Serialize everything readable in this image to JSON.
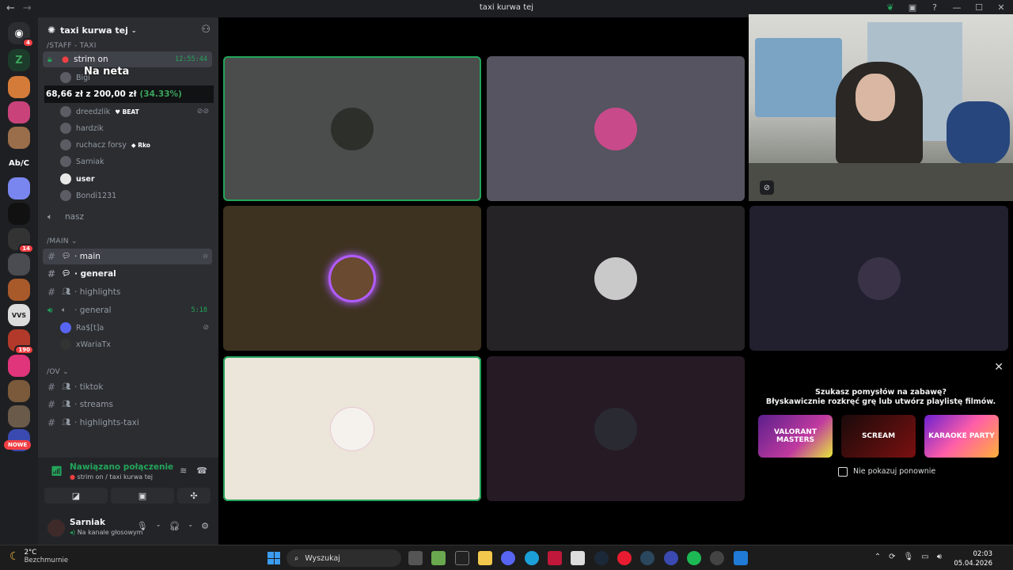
{
  "window": {
    "title": "taxi kurwa tej",
    "back_icon": "←",
    "forward_icon": "→"
  },
  "rail": {
    "badges": {
      "discord": "4",
      "server_14": "14",
      "server_190": "190"
    },
    "abc_label": "Ab/C",
    "vvs_label": "VVS",
    "new_label": "NOWE"
  },
  "sidebar": {
    "server_name": "taxi kurwa tej",
    "categories": {
      "staff": "/STAFF - TAXI",
      "main": "/MAIN",
      "ov": "/OV"
    },
    "voice_channel": {
      "name": "strim on",
      "time": "12:55:44"
    },
    "voice_users": [
      {
        "name": "Bigi"
      },
      {
        "name": "dreedzlik",
        "tag": "BEAT"
      },
      {
        "name": "hardzik"
      },
      {
        "name": "ruchacz forsy",
        "tag": "Rko"
      },
      {
        "name": "Sarniak"
      },
      {
        "name": "user"
      },
      {
        "name": "Bondi1231"
      }
    ],
    "nasz_label": "nasz",
    "main_channels": [
      {
        "name": "main"
      },
      {
        "name": "general"
      },
      {
        "name": "highlights"
      }
    ],
    "voice_general": {
      "name": "general",
      "time": "5:18"
    },
    "general_users": [
      {
        "name": "Ra$[t]a"
      },
      {
        "name": "xWariaTx"
      }
    ],
    "ov_channels": [
      {
        "name": "tiktok"
      },
      {
        "name": "streams"
      },
      {
        "name": "highlights-taxi"
      }
    ]
  },
  "overlay": {
    "na_neta": "Na neta",
    "amount": "68,66 zł z 200,00 zł",
    "percent": "(34.33%)"
  },
  "voice_panel": {
    "status": "Nawiązano połączenie",
    "location": "strim on / taxi kurwa tej"
  },
  "user": {
    "name": "Sarniak",
    "status": "Na kanale głosowym"
  },
  "suggestion": {
    "line1": "Szukasz pomysłów na zabawę?",
    "line2": "Błyskawicznie rozkręć grę lub utwórz playlistę filmów.",
    "cards": [
      "VALORANT MASTERS",
      "SCREAM",
      "KARAOKE PARTY"
    ],
    "checkbox_label": "Nie pokazuj ponownie"
  },
  "taskbar": {
    "temp": "2°C",
    "weather": "Bezchmurnie",
    "search_placeholder": "Wyszukaj",
    "time": "02:03",
    "date": "05.04.2026"
  },
  "colors": {
    "accent_green": "#23a55a",
    "sidebar": "#2b2d31",
    "rail": "#1e1f22"
  }
}
